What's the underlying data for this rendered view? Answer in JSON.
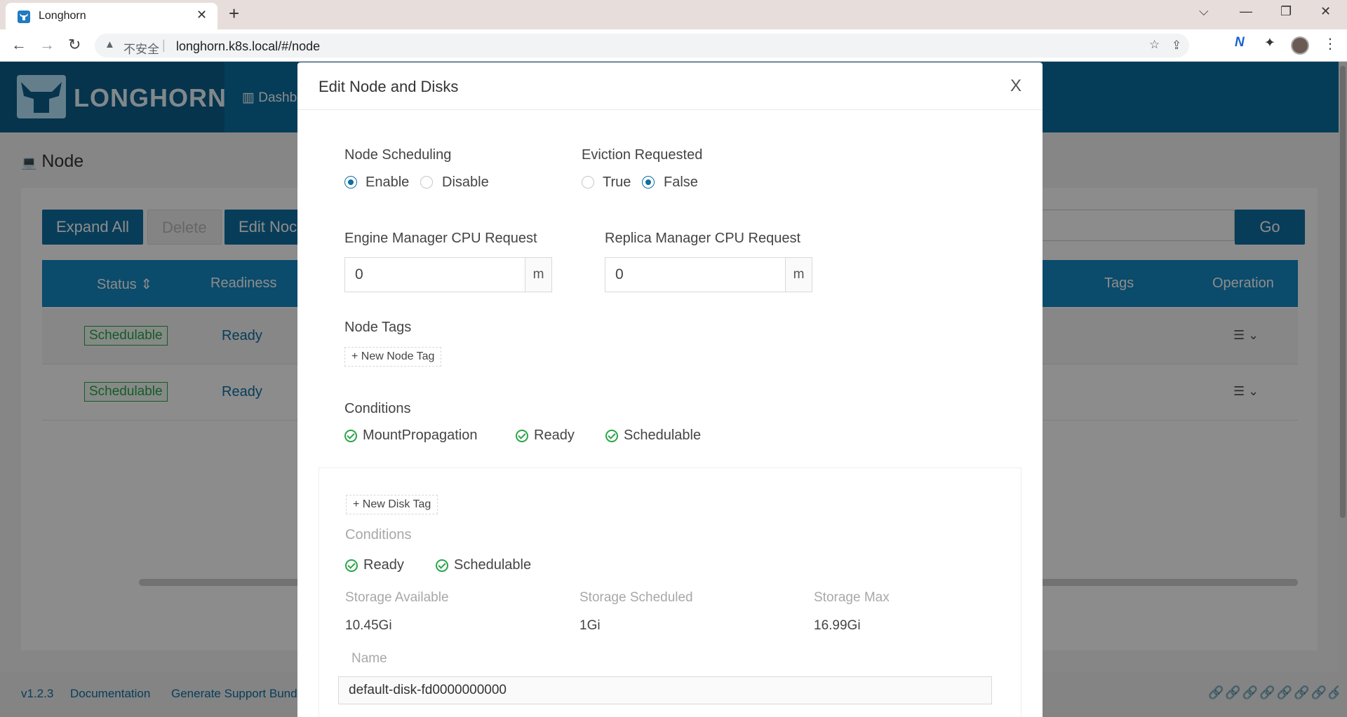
{
  "browser": {
    "tab_title": "Longhorn",
    "tab_close": "✕",
    "new_tab": "+",
    "insecure_label": "不安全",
    "url": "longhorn.k8s.local/#/node"
  },
  "app": {
    "logo_text": "LONGHORN",
    "nav_dashboard": "Dashb",
    "page_title": "Node",
    "toolbar": {
      "expand_all": "Expand All",
      "delete": "Delete",
      "edit_node": "Edit Noc",
      "go": "Go"
    },
    "table": {
      "headers": {
        "status": "Status",
        "readiness": "Readiness",
        "tags": "Tags",
        "operation": "Operation"
      },
      "rows": [
        {
          "status": "Schedulable",
          "readiness": "Ready"
        },
        {
          "status": "Schedulable",
          "readiness": "Ready"
        }
      ]
    },
    "footer": {
      "version": "v1.2.3",
      "documentation": "Documentation",
      "support_bundle": "Generate Support Bund"
    }
  },
  "modal": {
    "title": "Edit Node and Disks",
    "close": "X",
    "node_scheduling": {
      "label": "Node Scheduling",
      "enable": "Enable",
      "disable": "Disable",
      "selected": "Enable"
    },
    "eviction_requested": {
      "label": "Eviction Requested",
      "true_label": "True",
      "false_label": "False",
      "selected": "False"
    },
    "engine_cpu": {
      "label": "Engine Manager CPU Request",
      "value": "0",
      "unit": "m"
    },
    "replica_cpu": {
      "label": "Replica Manager CPU Request",
      "value": "0",
      "unit": "m"
    },
    "node_tags": {
      "label": "Node Tags",
      "new_tag": "+ New Node Tag"
    },
    "conditions": {
      "label": "Conditions",
      "items": [
        "MountPropagation",
        "Ready",
        "Schedulable"
      ]
    },
    "disk": {
      "new_tag": "+ New Disk Tag",
      "conditions_label": "Conditions",
      "conditions": [
        "Ready",
        "Schedulable"
      ],
      "storage_available_label": "Storage Available",
      "storage_available": "10.45Gi",
      "storage_scheduled_label": "Storage Scheduled",
      "storage_scheduled": "1Gi",
      "storage_max_label": "Storage Max",
      "storage_max": "16.99Gi",
      "name_label": "Name",
      "name_value": "default-disk-fd0000000000"
    }
  },
  "colors": {
    "primary": "#0f6fa3",
    "header": "#0a6fa3",
    "success": "#2aa54a"
  }
}
